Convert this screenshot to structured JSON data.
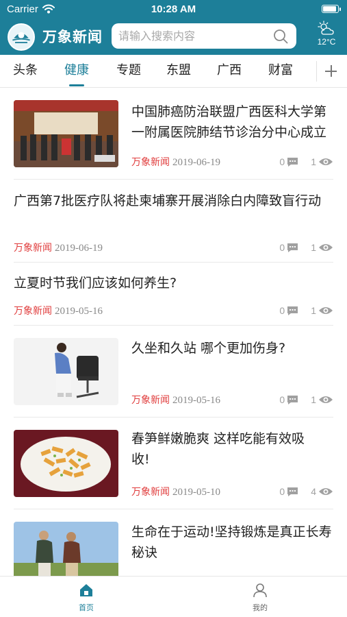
{
  "status_bar": {
    "carrier": "Carrier",
    "time": "10:28 AM"
  },
  "header": {
    "app_title": "万象新闻",
    "search_placeholder": "请输入搜索内容",
    "weather_temp": "12°C"
  },
  "tabs": [
    "头条",
    "健康",
    "专题",
    "东盟",
    "广西",
    "财富"
  ],
  "active_tab": "健康",
  "articles": [
    {
      "title": "中国肺癌防治联盟广西医科大学第一附属医院肺结节诊治分中心成立",
      "source": "万象新闻",
      "date": "2019-06-19",
      "comments": "0",
      "views": "1",
      "has_image": true
    },
    {
      "title": "广西第7批医疗队将赴柬埔寨开展消除白内障致盲行动",
      "source": "万象新闻",
      "date": "2019-06-19",
      "comments": "0",
      "views": "1",
      "has_image": false
    },
    {
      "title": "立夏时节我们应该如何养生?",
      "source": "万象新闻",
      "date": "2019-05-16",
      "comments": "0",
      "views": "1",
      "has_image": false
    },
    {
      "title": "久坐和久站 哪个更加伤身?",
      "source": "万象新闻",
      "date": "2019-05-16",
      "comments": "0",
      "views": "1",
      "has_image": true
    },
    {
      "title": "春笋鲜嫩脆爽 这样吃能有效吸收!",
      "source": "万象新闻",
      "date": "2019-05-10",
      "comments": "0",
      "views": "4",
      "has_image": true
    },
    {
      "title": "生命在于运动!坚持锻炼是真正长寿秘诀",
      "has_image": true
    }
  ],
  "bottom_nav": {
    "home": "首页",
    "me": "我的"
  },
  "colors": {
    "brand": "#1d7f99",
    "source_red": "#e03c3c"
  }
}
